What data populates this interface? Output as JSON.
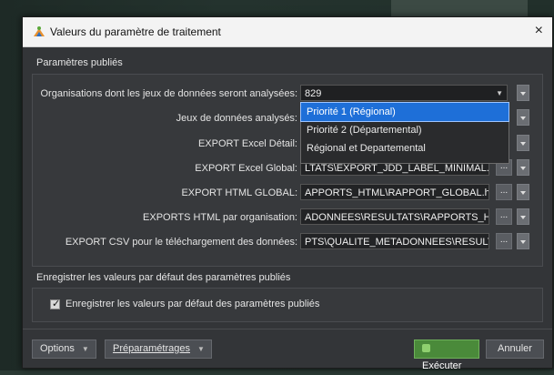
{
  "window": {
    "title": "Valeurs du paramètre de traitement",
    "close_glyph": "×"
  },
  "published_section": {
    "label": "Paramètres publiés"
  },
  "rows": [
    {
      "label": "Organisations dont les jeux de données seront analysées:",
      "value": "829"
    },
    {
      "label": "Jeux de données analysés:",
      "value": ""
    },
    {
      "label": "EXPORT Excel Détail:",
      "value": ""
    },
    {
      "label": "EXPORT Excel Global:",
      "value": "LTATS\\EXPORT_JDD_LABEL_MINIMAL.xlsx\""
    },
    {
      "label": "EXPORT HTML GLOBAL:",
      "value": "APPORTS_HTML\\RAPPORT_GLOBAL.html\""
    },
    {
      "label": "EXPORTS HTML par organisation:",
      "value": "ADONNEES\\RESULTATS\\RAPPORTS_HTML\""
    },
    {
      "label": "EXPORT CSV pour le téléchargement des données:",
      "value": "PTS\\QUALITE_METADONNEES\\RESULTATS\""
    }
  ],
  "dropdown_options": [
    {
      "label": "Priorité 1 (Régional)",
      "selected": true
    },
    {
      "label": "Priorité 2 (Départemental)",
      "selected": false
    },
    {
      "label": "Régional et Departemental",
      "selected": false
    }
  ],
  "dots_label": "...",
  "defaults_section": {
    "label": "Enregistrer les valeurs par défaut des paramètres publiés"
  },
  "defaults_checkbox": {
    "label": "Enregistrer les valeurs par défaut des paramètres publiés",
    "checked": true
  },
  "footer": {
    "options_label": "Options",
    "presets_label": "Préparamétrages",
    "execute_label": "Exécuter",
    "cancel_label": "Annuler"
  },
  "colors": {
    "selection": "#1e6fd8",
    "execute": "#4a8a3a",
    "dialog_bg": "#333538"
  }
}
